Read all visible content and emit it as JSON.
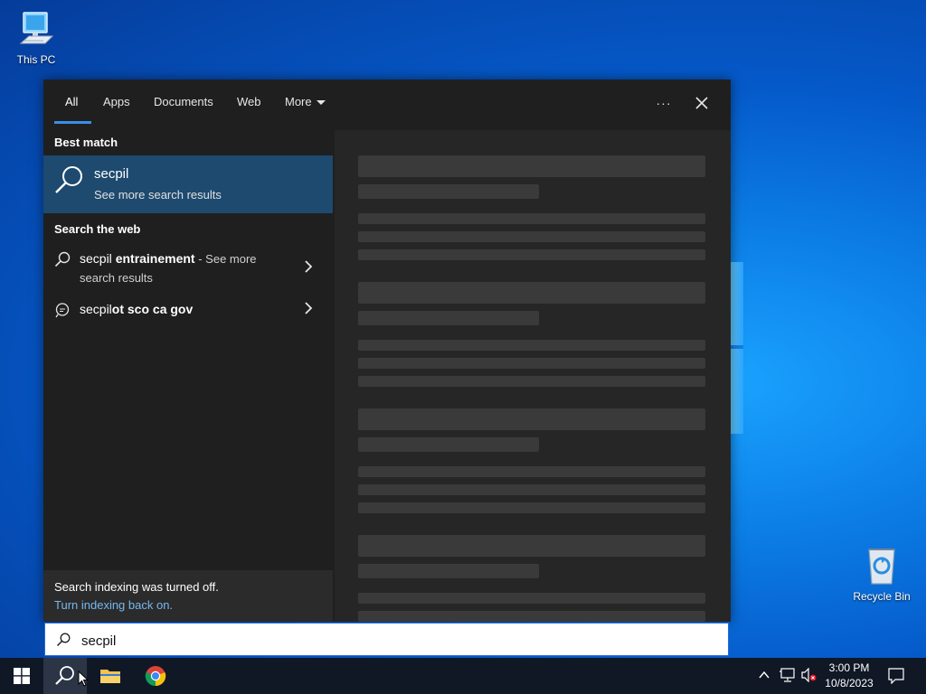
{
  "desktop": {
    "icons": [
      {
        "label": "This PC"
      },
      {
        "label": "Recycle Bin"
      }
    ]
  },
  "search_panel": {
    "tabs": [
      {
        "label": "All",
        "active": true
      },
      {
        "label": "Apps"
      },
      {
        "label": "Documents"
      },
      {
        "label": "Web"
      },
      {
        "label": "More"
      }
    ],
    "more_options_label": "···",
    "best_match": {
      "heading": "Best match",
      "title": "secpil",
      "subtitle": "See more search results"
    },
    "search_web": {
      "heading": "Search the web",
      "items": [
        {
          "prefix": "secpil ",
          "bold": "entrainement",
          "suffix": " - See more",
          "line2": "search results"
        },
        {
          "prefix": "secpil",
          "bold": "ot sco ca gov"
        }
      ]
    },
    "notice": {
      "text": "Search indexing was turned off.",
      "link": "Turn indexing back on."
    },
    "query": "secpil"
  },
  "taskbar": {
    "time": "3:00 PM",
    "date": "10/8/2023"
  },
  "colors": {
    "accent": "#3a8ee6",
    "best_match_bg": "#1d4a6e",
    "link": "#74b8f3"
  }
}
